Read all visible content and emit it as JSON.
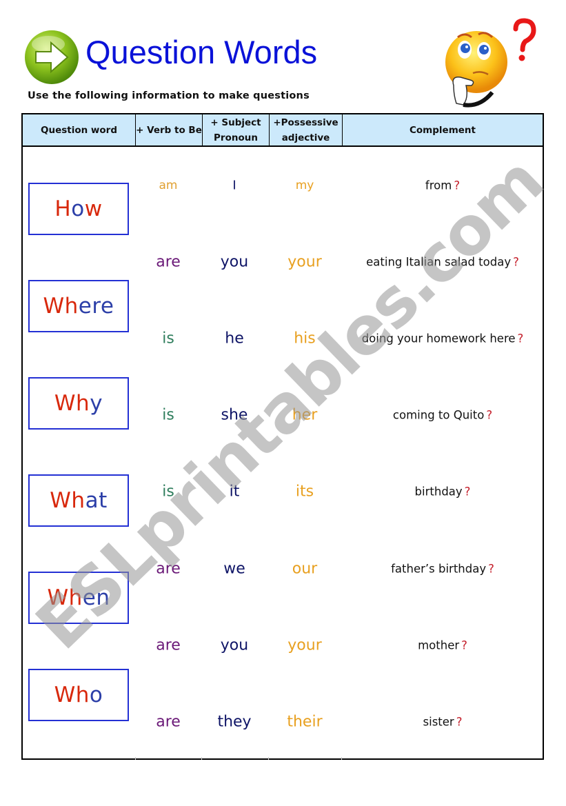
{
  "header": {
    "title": "Question Words",
    "instruction": "Use the following information to make questions",
    "icons": {
      "logo": "green-arrow-button-icon",
      "mascot": "thinking-smiley-with-question-mark-icon"
    }
  },
  "table": {
    "columns": [
      {
        "label": "Question word"
      },
      {
        "label": "+ Verb to Be"
      },
      {
        "label": "+ Subject Pronoun"
      },
      {
        "label": "+Possessive adjective"
      },
      {
        "label": "Complement"
      }
    ],
    "question_words": [
      {
        "word": "How",
        "parts": [
          {
            "t": "H",
            "c": "red"
          },
          {
            "t": "o",
            "c": "blue"
          },
          {
            "t": "w",
            "c": "red"
          }
        ]
      },
      {
        "word": "Where",
        "parts": [
          {
            "t": "Wh",
            "c": "red"
          },
          {
            "t": "ere",
            "c": "blue"
          }
        ]
      },
      {
        "word": "Why",
        "parts": [
          {
            "t": "Wh",
            "c": "red"
          },
          {
            "t": "y",
            "c": "blue"
          }
        ]
      },
      {
        "word": "What",
        "parts": [
          {
            "t": "Wh",
            "c": "red"
          },
          {
            "t": "at",
            "c": "blue"
          }
        ]
      },
      {
        "word": "When",
        "parts": [
          {
            "t": "Wh",
            "c": "red"
          },
          {
            "t": "en",
            "c": "blue"
          }
        ]
      },
      {
        "word": "Who",
        "parts": [
          {
            "t": "Wh",
            "c": "red"
          },
          {
            "t": "o",
            "c": "blue"
          }
        ]
      }
    ],
    "rows": [
      {
        "verb": "am",
        "pronoun": "I",
        "possessive": "my",
        "complement": "from",
        "qmark": "?"
      },
      {
        "verb": "are",
        "pronoun": "you",
        "possessive": "your",
        "complement": "eating Italian salad today",
        "qmark": "?"
      },
      {
        "verb": "is",
        "pronoun": "he",
        "possessive": "his",
        "complement": "doing your homework here",
        "qmark": "?"
      },
      {
        "verb": "is",
        "pronoun": "she",
        "possessive": "her",
        "complement": "coming to Quito",
        "qmark": "?"
      },
      {
        "verb": "is",
        "pronoun": "it",
        "possessive": "its",
        "complement": "birthday",
        "qmark": "?"
      },
      {
        "verb": "are",
        "pronoun": "we",
        "possessive": "our",
        "complement": "father’s birthday",
        "qmark": "?"
      },
      {
        "verb": "are",
        "pronoun": "you",
        "possessive": "your",
        "complement": "mother",
        "qmark": "?"
      },
      {
        "verb": "are",
        "pronoun": "they",
        "possessive": "their",
        "complement": "sister",
        "qmark": "?"
      }
    ]
  },
  "colors": {
    "title": "#0a12d8",
    "header_bg": "#cce9fb",
    "box_border": "#2330d4",
    "word_red": "#d8280c",
    "word_blue": "#2c3fa8",
    "verb_are": "#6b1a78",
    "verb_is": "#2e7d5c",
    "verb_am": "#e0a030",
    "pronoun": "#0e1466",
    "possessive": "#e8a020",
    "question_mark": "#c41e2a"
  },
  "watermark": "ESLprintables.com"
}
